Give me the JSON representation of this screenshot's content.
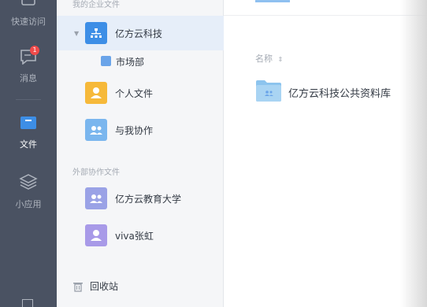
{
  "rail": {
    "items": [
      {
        "label": "快速访问",
        "icon": "clock-icon"
      },
      {
        "label": "消息",
        "icon": "message-icon",
        "badge": "1"
      },
      {
        "label": "文件",
        "icon": "folder-icon",
        "active": true
      },
      {
        "label": "小应用",
        "icon": "apps-icon"
      }
    ]
  },
  "panel": {
    "enterprise_section": "我的企业文件",
    "org": {
      "label": "亿方云科技",
      "color": "#3d8ee6"
    },
    "sub": {
      "label": "市场部"
    },
    "personal": {
      "label": "个人文件",
      "color": "#f6b93a"
    },
    "shared": {
      "label": "与我协作",
      "color": "#7ab6ee"
    },
    "external_section": "外部协作文件",
    "external": [
      {
        "label": "亿方云教育大学",
        "color": "#9aa2e6"
      },
      {
        "label": "viva张虹",
        "color": "#a89ae8"
      }
    ],
    "trash": {
      "label": "回收站"
    }
  },
  "main": {
    "column_name": "名称",
    "folders": [
      {
        "name": "亿方云科技公共资料库"
      }
    ]
  }
}
